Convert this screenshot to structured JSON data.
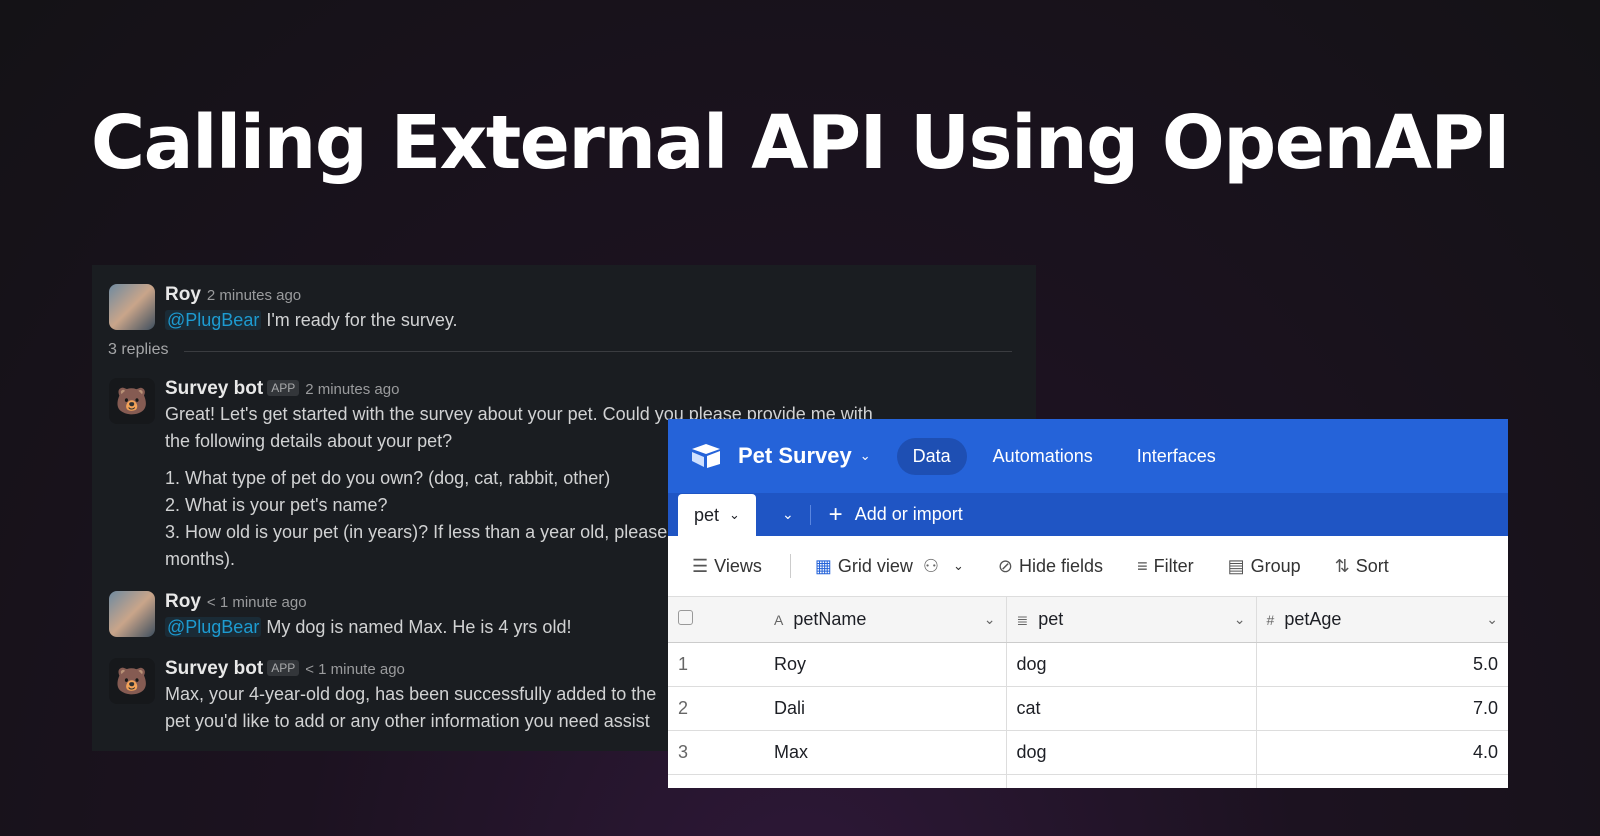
{
  "title": "Calling External API Using OpenAPI",
  "chat": {
    "replies": "3 replies",
    "messages": [
      {
        "author": "Roy",
        "time": "2 minutes ago",
        "mention": "@PlugBear",
        "text": "I'm ready for the survey."
      },
      {
        "author": "Survey bot",
        "badge": "APP",
        "time": "2 minutes ago",
        "lines": [
          "Great! Let's get started with the survey about your pet. Could you please provide me with",
          "the following details about your pet?",
          "1.  What type of pet do you own? (dog, cat, rabbit, other)",
          "2.  What is your pet's name?",
          "3.  How old is your pet (in years)? If less than a year old, please",
          "months)."
        ]
      },
      {
        "author": "Roy",
        "time": "< 1 minute ago",
        "mention": "@PlugBear",
        "text": "My dog is named Max. He is 4 yrs old!"
      },
      {
        "author": "Survey bot",
        "badge": "APP",
        "time": "< 1 minute ago",
        "lines": [
          "Max, your 4-year-old dog, has been successfully added to the",
          "pet you'd like to add or any other information you need assist"
        ]
      }
    ]
  },
  "airtable": {
    "base": "Pet Survey",
    "nav": [
      "Data",
      "Automations",
      "Interfaces"
    ],
    "table_tab": "pet",
    "add": "Add or import",
    "toolbar": {
      "views": "Views",
      "grid": "Grid view",
      "hide": "Hide fields",
      "filter": "Filter",
      "group": "Group",
      "sort": "Sort"
    },
    "columns": [
      "petName",
      "pet",
      "petAge"
    ],
    "rows": [
      {
        "n": "1",
        "petName": "Roy",
        "pet": "dog",
        "petAge": "5.0"
      },
      {
        "n": "2",
        "petName": "Dali",
        "pet": "cat",
        "petAge": "7.0"
      },
      {
        "n": "3",
        "petName": "Max",
        "pet": "dog",
        "petAge": "4.0"
      }
    ],
    "colors": {
      "header": "#2563d9",
      "tabbar": "#1f55c4"
    }
  }
}
